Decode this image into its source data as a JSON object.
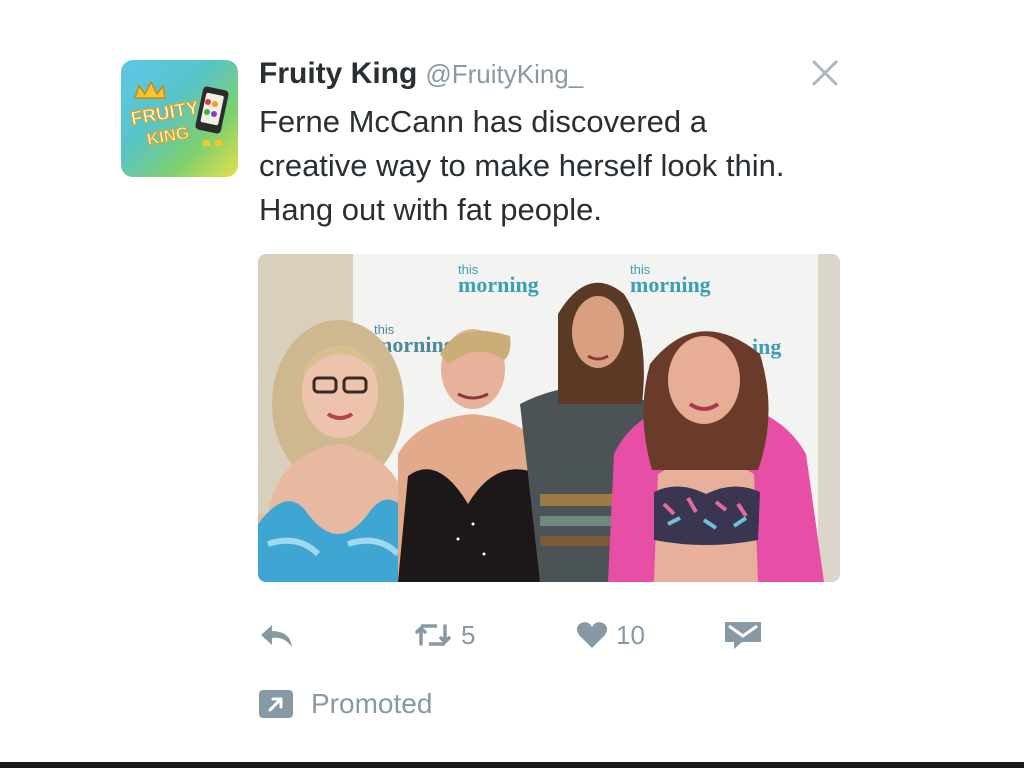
{
  "tweet": {
    "display_name": "Fruity King",
    "handle": "@FruityKing_",
    "text": "Ferne McCann has discovered a creative way to make herself look thin. Hang out with fat people.",
    "avatar": {
      "icon": "fruity-king-logo",
      "logo_text_top": "FRUITY",
      "logo_text_bottom": "KING"
    },
    "close_icon": "close-icon",
    "media": {
      "backdrop_text_line1": "this",
      "backdrop_text_line2": "morning"
    },
    "actions": {
      "reply_icon": "reply-icon",
      "retweet_icon": "retweet-icon",
      "retweet_count": "5",
      "like_icon": "heart-icon",
      "like_count": "10",
      "dm_icon": "envelope-icon"
    },
    "promoted": {
      "icon": "promoted-arrow-icon",
      "label": "Promoted"
    }
  },
  "colors": {
    "text_primary": "#292f33",
    "text_secondary": "#8899a6",
    "background": "#ffffff"
  }
}
